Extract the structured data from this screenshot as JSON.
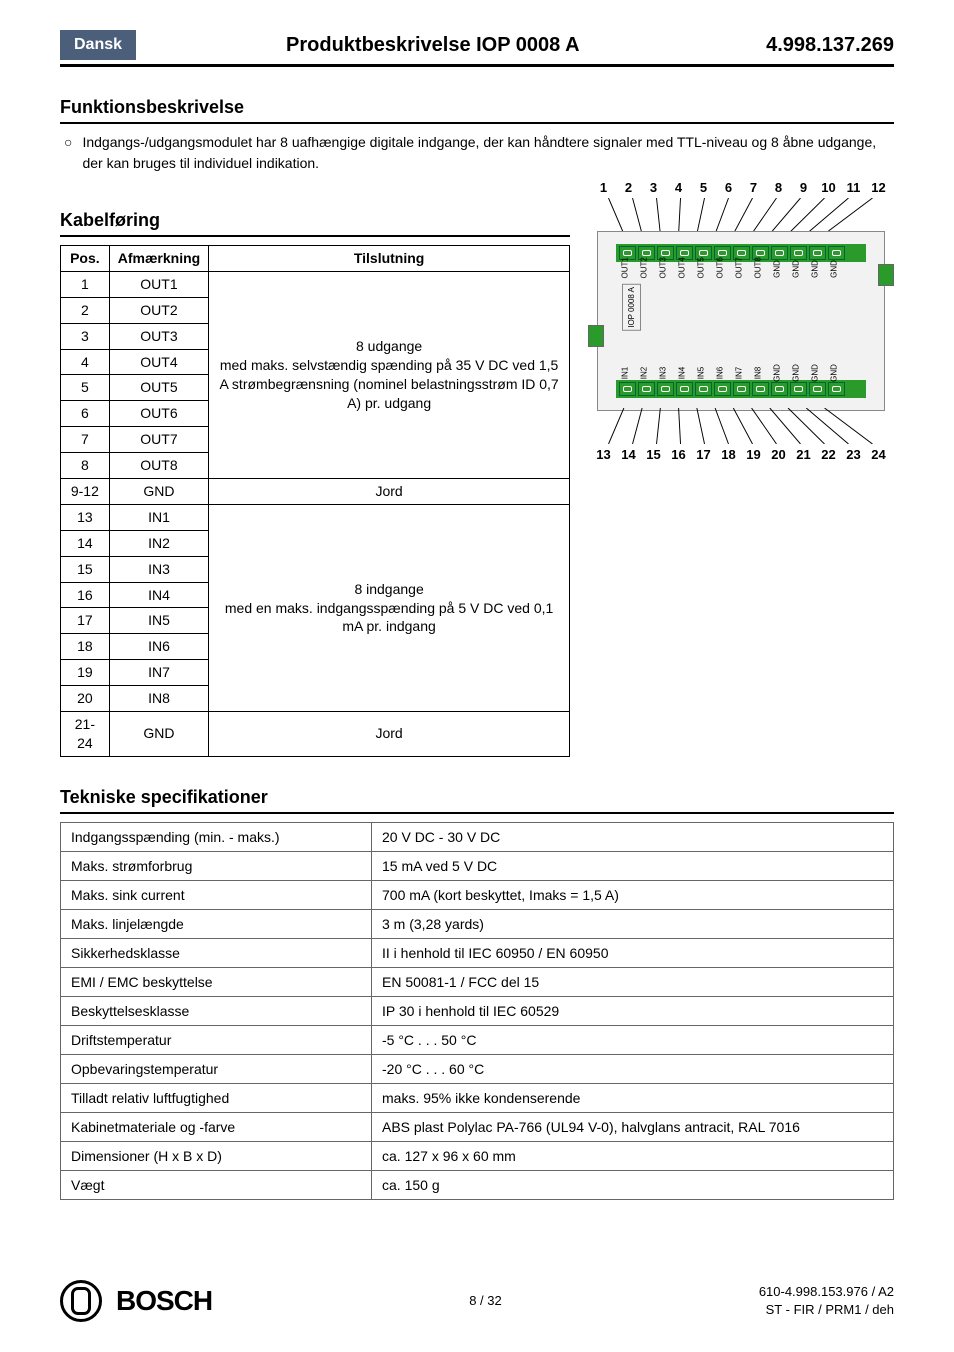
{
  "header": {
    "language": "Dansk",
    "title": "Produktbeskrivelse IOP 0008 A",
    "code": "4.998.137.269"
  },
  "funcDesc": {
    "heading": "Funktionsbeskrivelse",
    "bullet": "Indgangs-/udgangsmodulet har 8 uafhængige digitale indgange, der kan håndtere signaler med TTL-niveau og 8 åbne udgange, der kan bruges til individuel indikation."
  },
  "wiring": {
    "heading": "Kabelføring",
    "headers": {
      "pos": "Pos.",
      "marking": "Afmærkning",
      "conn": "Tilslutning"
    },
    "rows": [
      {
        "pos": "1",
        "marking": "OUT1"
      },
      {
        "pos": "2",
        "marking": "OUT2"
      },
      {
        "pos": "3",
        "marking": "OUT3"
      },
      {
        "pos": "4",
        "marking": "OUT4"
      },
      {
        "pos": "5",
        "marking": "OUT5"
      },
      {
        "pos": "6",
        "marking": "OUT6"
      },
      {
        "pos": "7",
        "marking": "OUT7"
      },
      {
        "pos": "8",
        "marking": "OUT8"
      },
      {
        "pos": "9-12",
        "marking": "GND"
      },
      {
        "pos": "13",
        "marking": "IN1"
      },
      {
        "pos": "14",
        "marking": "IN2"
      },
      {
        "pos": "15",
        "marking": "IN3"
      },
      {
        "pos": "16",
        "marking": "IN4"
      },
      {
        "pos": "17",
        "marking": "IN5"
      },
      {
        "pos": "18",
        "marking": "IN6"
      },
      {
        "pos": "19",
        "marking": "IN7"
      },
      {
        "pos": "20",
        "marking": "IN8"
      },
      {
        "pos": "21-24",
        "marking": "GND"
      }
    ],
    "conn_out": "8 udgange\nmed maks. selvstændig spænding på 35 V DC ved 1,5 A strømbegrænsning (nominel belastningsstrøm ID 0,7 A) pr. udgang",
    "conn_gnd": "Jord",
    "conn_in": "8 indgange\nmed en maks. indgangsspænding på 5 V DC ved 0,1 mA pr. indgang"
  },
  "diagram": {
    "top_numbers": [
      "1",
      "2",
      "3",
      "4",
      "5",
      "6",
      "7",
      "8",
      "9",
      "10",
      "11",
      "12"
    ],
    "bot_numbers": [
      "13",
      "14",
      "15",
      "16",
      "17",
      "18",
      "19",
      "20",
      "21",
      "22",
      "23",
      "24"
    ],
    "top_labels": [
      "OUT1",
      "OUT2",
      "OUT3",
      "OUT4",
      "OUT5",
      "OUT6",
      "OUT7",
      "OUT8",
      "GND",
      "GND",
      "GND",
      "GND"
    ],
    "bot_labels": [
      "IN1",
      "IN2",
      "IN3",
      "IN4",
      "IN5",
      "IN6",
      "IN7",
      "IN8",
      "GND",
      "GND",
      "GND",
      "GND"
    ],
    "chip_label": "IOP 0008 A"
  },
  "specs": {
    "heading": "Tekniske specifikationer",
    "rows": [
      [
        "Indgangsspænding (min. - maks.)",
        "20 V DC - 30 V DC"
      ],
      [
        "Maks. strømforbrug",
        "15 mA ved 5 V DC"
      ],
      [
        "Maks. sink current",
        "700 mA (kort beskyttet, Imaks = 1,5 A)"
      ],
      [
        "Maks. linjelængde",
        "3 m  (3,28 yards)"
      ],
      [
        "Sikkerhedsklasse",
        "II i henhold til IEC 60950 / EN 60950"
      ],
      [
        "EMI / EMC beskyttelse",
        "EN 50081-1 / FCC del 15"
      ],
      [
        "Beskyttelsesklasse",
        "IP 30 i henhold til IEC 60529"
      ],
      [
        "Driftstemperatur",
        "-5 °C . . . 50 °C"
      ],
      [
        "Opbevaringstemperatur",
        "-20 °C . . . 60 °C"
      ],
      [
        "Tilladt relativ luftfugtighed",
        "maks. 95% ikke kondenserende"
      ],
      [
        "Kabinetmateriale og -farve",
        "ABS plast Polylac PA-766 (UL94 V-0), halvglans antracit, RAL 7016"
      ],
      [
        "Dimensioner (H x B x D)",
        "ca. 127 x 96 x 60 mm"
      ],
      [
        "Vægt",
        "ca. 150 g"
      ]
    ]
  },
  "footer": {
    "brand": "BOSCH",
    "page": "8 / 32",
    "ref1": "610-4.998.153.976 / A2",
    "ref2": "ST - FIR / PRM1 / deh"
  }
}
